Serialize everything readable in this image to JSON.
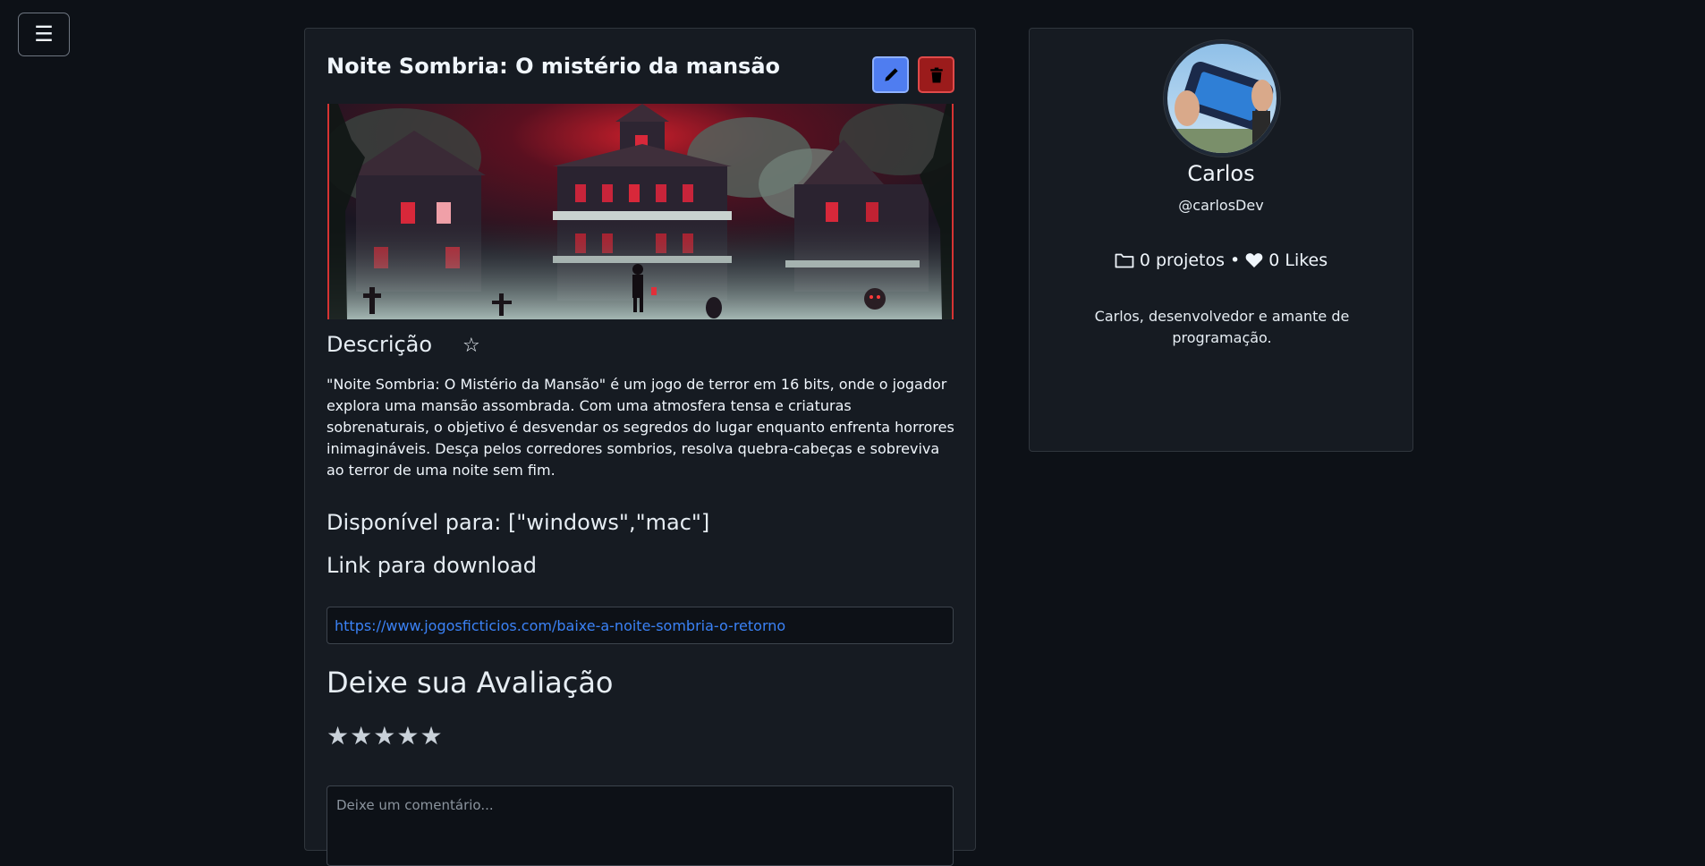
{
  "nav": {
    "menu_glyph": "☰"
  },
  "project": {
    "title": "Noite Sombria: O mistério da mansão",
    "cover_icon": "haunted-mansion-pixel-art",
    "edit_icon": "pencil-icon",
    "delete_icon": "trash-icon",
    "description_heading": "Descrição",
    "favorite_glyph": "☆",
    "description": "\"Noite Sombria: O Mistério da Mansão\" é um jogo de terror em 16 bits, onde o jogador explora uma mansão assombrada. Com uma atmosfera tensa e criaturas sobrenaturais, o objetivo é desvendar os segredos do lugar enquanto enfrenta horrores inimagináveis. Desça pelos corredores sombrios, resolva quebra-cabeças e sobreviva ao terror de uma noite sem fim.",
    "platforms": "Disponível para: [\"windows\",\"mac\"]",
    "download_heading": "Link para download",
    "download_url": "https://www.jogosficticios.com/baixe-a-noite-sombria-o-retorno"
  },
  "review": {
    "heading": "Deixe sua Avaliação",
    "stars": [
      "★",
      "★",
      "★",
      "★",
      "★"
    ],
    "rating_value": 0,
    "comment_placeholder": "Deixe um comentário..."
  },
  "profile": {
    "name": "Carlos",
    "handle": "@carlosDev",
    "projects": "0 projetos",
    "separator": "•",
    "likes": "0 Likes",
    "bio": "Carlos, desenvolvedor e amante de programação."
  },
  "colors": {
    "background": "#0d1117",
    "card": "#161b22",
    "edit_button": "#4f7df0",
    "delete_button": "#9b1b1b",
    "link": "#3b82f6"
  }
}
